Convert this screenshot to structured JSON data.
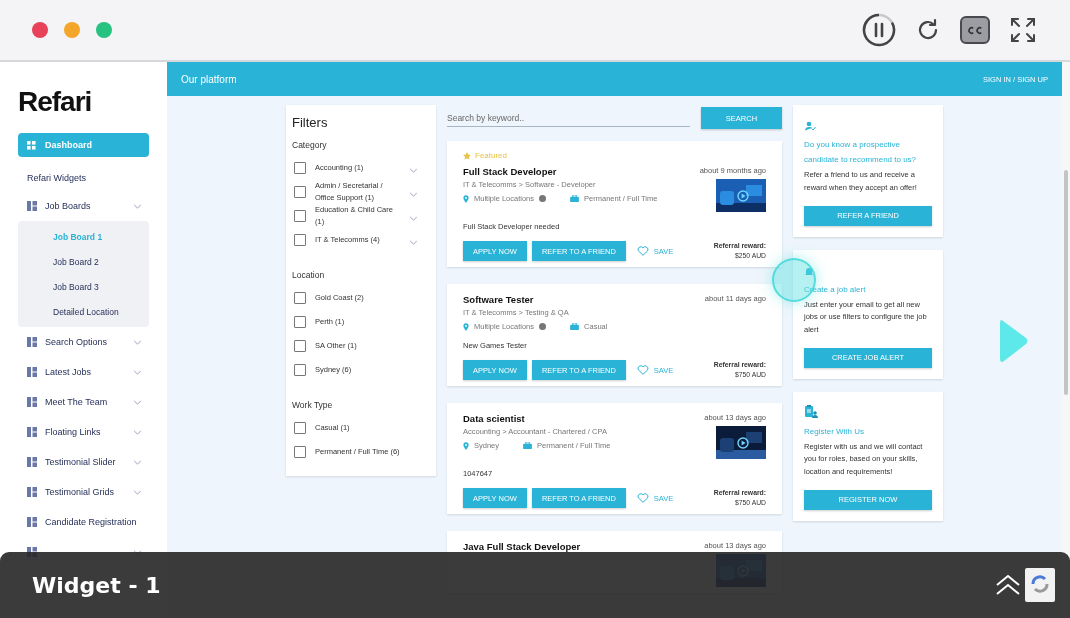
{
  "player": {
    "captions_on": true
  },
  "header": {
    "title": "Our platform",
    "auth_link": "SIGN IN / SIGN UP"
  },
  "sidebar": {
    "logo": "Refari",
    "items": [
      {
        "kind": "button",
        "label": "Dashboard",
        "selected": true
      },
      {
        "kind": "heading",
        "label": "Refari Widgets"
      },
      {
        "kind": "group",
        "label": "Job Boards",
        "children": [
          {
            "label": "Job Board 1",
            "selected": true
          },
          {
            "label": "Job Board 2",
            "selected": false
          },
          {
            "label": "Job Board 3",
            "selected": false
          },
          {
            "label": "Detailed Location",
            "selected": false
          }
        ]
      },
      {
        "kind": "group",
        "label": "Search Options"
      },
      {
        "kind": "group",
        "label": "Latest Jobs"
      },
      {
        "kind": "group",
        "label": "Meet The Team"
      },
      {
        "kind": "group",
        "label": "Floating Links"
      },
      {
        "kind": "group",
        "label": "Testimonial Slider"
      },
      {
        "kind": "group",
        "label": "Testimonial Grids"
      },
      {
        "kind": "link",
        "label": "Candidate Registration"
      },
      {
        "kind": "group"
      }
    ]
  },
  "filters": {
    "title": "Filters",
    "groups": [
      {
        "heading": "Category",
        "options": [
          {
            "label": "Accounting (1)",
            "checked": false,
            "expandable": true
          },
          {
            "label": "Admin / Secretarial / Office Support (1)",
            "checked": false,
            "expandable": true
          },
          {
            "label": "Education & Child Care (1)",
            "checked": false,
            "expandable": true
          },
          {
            "label": "IT & Telecomms (4)",
            "checked": false,
            "expandable": true
          }
        ]
      },
      {
        "heading": "Location",
        "options": [
          {
            "label": "Gold Coast (2)",
            "checked": false,
            "expandable": false
          },
          {
            "label": "Perth (1)",
            "checked": false,
            "expandable": false
          },
          {
            "label": "SA Other (1)",
            "checked": false,
            "expandable": false
          },
          {
            "label": "Sydney (6)",
            "checked": false,
            "expandable": false
          }
        ]
      },
      {
        "heading": "Work Type",
        "options": [
          {
            "label": "Casual (1)",
            "checked": false,
            "expandable": false
          },
          {
            "label": "Permanent / Full Time (6)",
            "checked": false,
            "expandable": false
          }
        ]
      }
    ]
  },
  "search": {
    "placeholder": "Search by keyword..",
    "button": "SEARCH"
  },
  "jobs": [
    {
      "badge": "Featured",
      "title": "Full Stack Developer",
      "category": "IT & Telecomms > Software - Developer",
      "location": "Multiple Locations",
      "location_info": true,
      "work_type": "Permanent / Full Time",
      "posted": "about 9 months ago",
      "description": "Full Stack Developer needed",
      "apply": "APPLY NOW",
      "refer": "REFER TO A FRIEND",
      "save": "SAVE",
      "reward_label": "Referral reward:",
      "reward": "$250 AUD"
    },
    {
      "title": "Software Tester",
      "category": "IT & Telecomms > Testing & QA",
      "location": "Multiple Locations",
      "location_info": true,
      "work_type": "Casual",
      "posted": "about 11 days ago",
      "description": "New Games Tester",
      "apply": "APPLY NOW",
      "refer": "REFER TO A FRIEND",
      "save": "SAVE",
      "reward_label": "Referral reward:",
      "reward": "$750 AUD"
    },
    {
      "title": "Data scientist",
      "category": "Accounting > Accountant - Chartered / CPA",
      "location": "Sydney",
      "location_info": false,
      "work_type": "Permanent / Full Time",
      "posted": "about 13 days ago",
      "description": "1047647",
      "apply": "APPLY NOW",
      "refer": "REFER TO A FRIEND",
      "save": "SAVE",
      "reward_label": "Referral reward:",
      "reward": "$750 AUD"
    },
    {
      "title": "Java Full Stack Developer",
      "posted": "about 13 days ago"
    }
  ],
  "widgets": [
    {
      "kind": "referral",
      "title": "Do you know a prospective candidate to recommend to us?",
      "text": "Refer a friend to us and receive a reward when they accept an offer!",
      "button": "REFER A FRIEND"
    },
    {
      "kind": "bell",
      "title": "Create a job alert",
      "text": "Just enter your email to get all new jobs or use filters to configure the job alert",
      "button": "CREATE JOB ALERT"
    },
    {
      "kind": "clipboard",
      "title": "Register With Us",
      "text": "Register with us and we will contact you for roles, based on your skills, location and requirements!",
      "button": "REGISTER NOW"
    }
  ],
  "overlay": {
    "caption": "Widget - 1"
  }
}
